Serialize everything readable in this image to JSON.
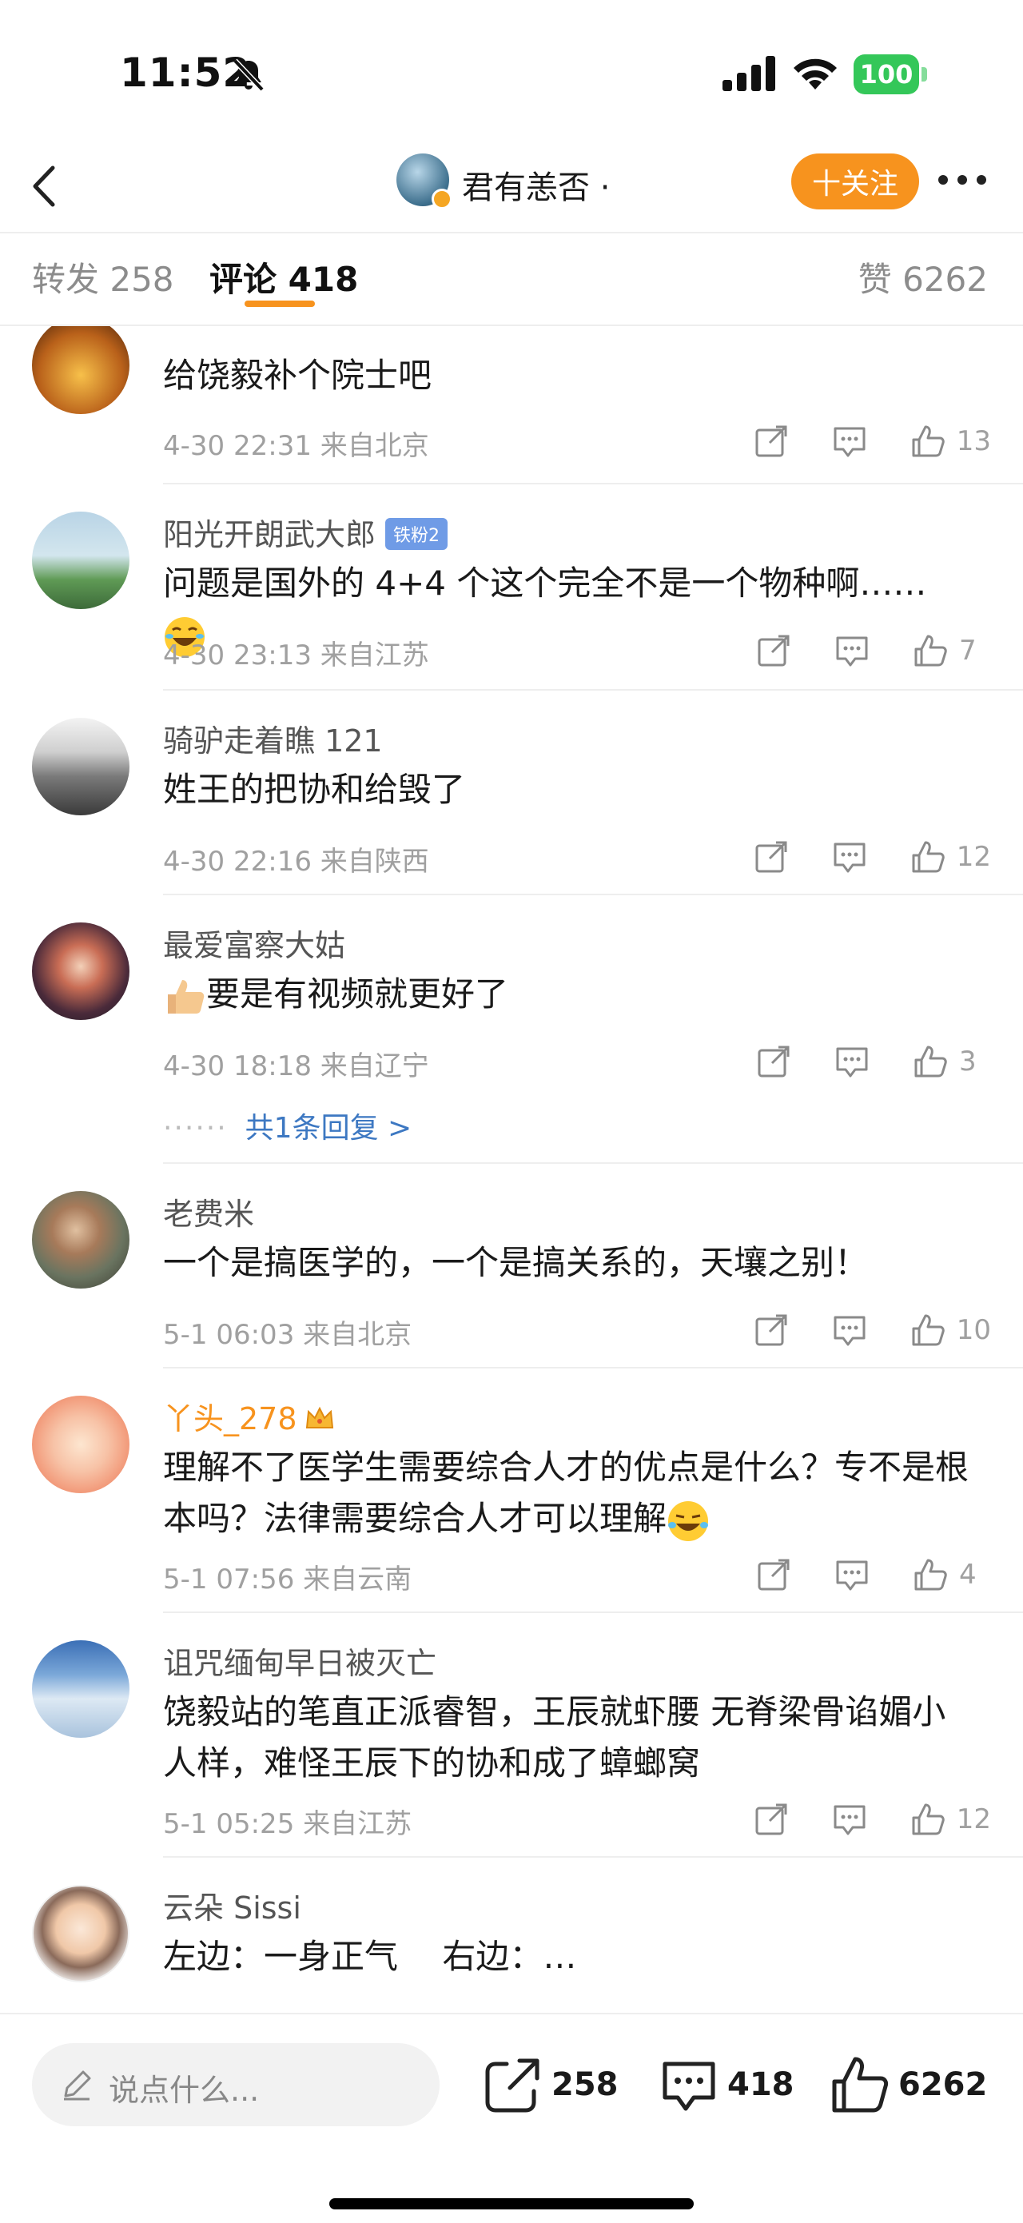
{
  "status_bar": {
    "time": "11:52",
    "battery": "100"
  },
  "nav": {
    "title": "君有恙否 ·",
    "follow_label": "十关注"
  },
  "tabs": {
    "repost": "转发 258",
    "comment": "评论 418",
    "like": "赞 6262"
  },
  "comments": [
    {
      "name": "",
      "text": "给饶毅补个院士吧",
      "time": "4-30 22:31",
      "location": "来自北京",
      "likes": "13"
    },
    {
      "name": "阳光开朗武大郎",
      "badge": "铁粉2",
      "text": "问题是国外的 4+4 个这个完全不是一个物种啊……",
      "time": "4-30 23:13",
      "location": "来自江苏",
      "likes": "7"
    },
    {
      "name": "骑驴走着瞧 121",
      "text": "姓王的把协和给毁了",
      "time": "4-30 22:16",
      "location": "来自陕西",
      "likes": "12"
    },
    {
      "name": "最爱富察大姑",
      "text": "要是有视频就更好了",
      "time": "4-30 18:18",
      "location": "来自辽宁",
      "likes": "3",
      "reply_link": "共1条回复 >"
    },
    {
      "name": "老费米",
      "text": "一个是搞医学的，一个是搞关系的，天壤之别！",
      "time": "5-1 06:03",
      "location": "来自北京",
      "likes": "10"
    },
    {
      "name": "丫头_278",
      "text": "理解不了医学生需要综合人才的优点是什么？专不是根本吗？法律需要综合人才可以理解",
      "time": "5-1 07:56",
      "location": "来自云南",
      "likes": "4"
    },
    {
      "name": "诅咒缅甸早日被灭亡",
      "text": "饶毅站的笔直正派睿智，王辰就虾腰 无脊梁骨谄媚小人样，难怪王辰下的协和成了蟑螂窝",
      "time": "5-1 05:25",
      "location": "来自江苏",
      "likes": "12"
    },
    {
      "name": "云朵 Sissi",
      "text": "左边：一身正气　 右边：…"
    }
  ],
  "bottom_bar": {
    "input_placeholder": "说点什么...",
    "repost_count": "258",
    "comment_count": "418",
    "like_count": "6262"
  },
  "colors": {
    "accent": "#f7931e",
    "link": "#3d78c2",
    "battery": "#34c759"
  }
}
